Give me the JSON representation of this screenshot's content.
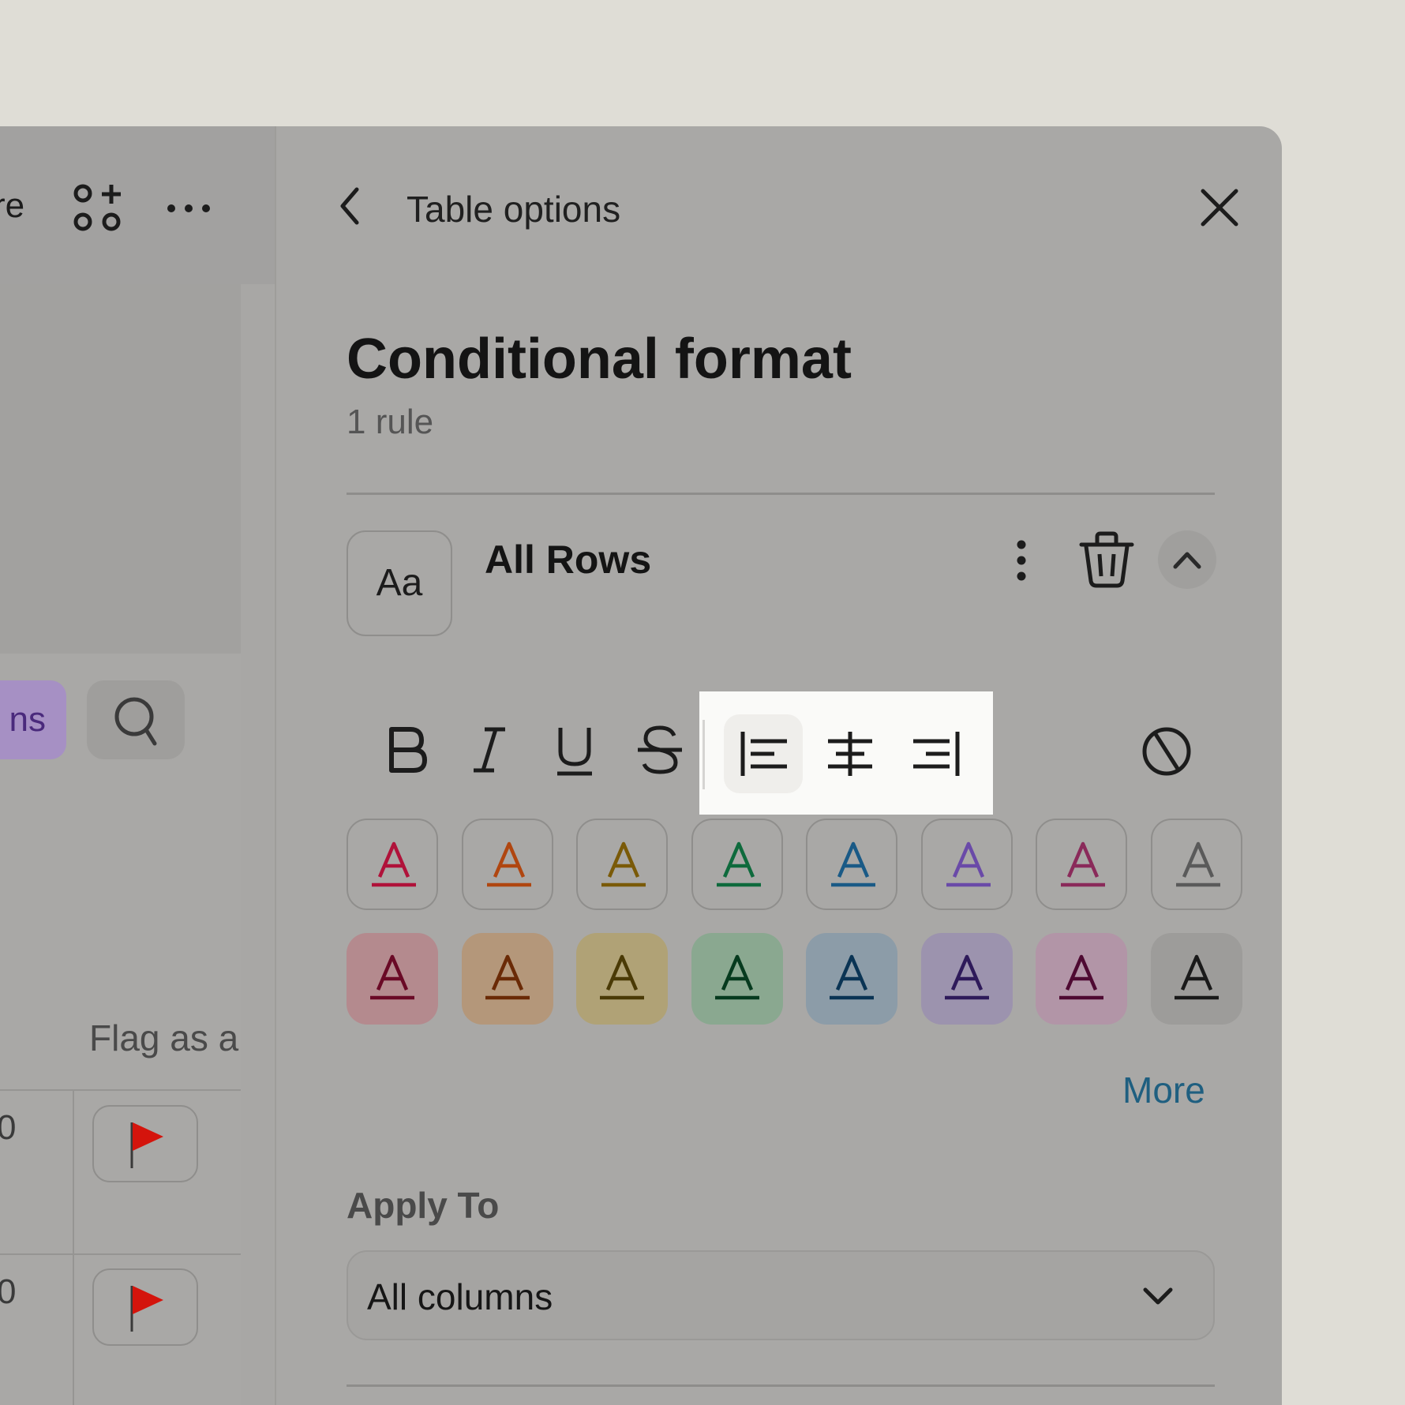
{
  "left": {
    "toolbar_text_fragment": "re",
    "pill_text_fragment": "ns",
    "column_header_fragment": "Flag as a",
    "rows": [
      {
        "value_fragment": "0"
      },
      {
        "value_fragment": "0"
      }
    ]
  },
  "panel": {
    "title": "Table options",
    "heading": "Conditional format",
    "subheading": "1 rule",
    "rule": {
      "preview_label": "Aa",
      "name": "All Rows"
    },
    "more_link": "More",
    "apply_to": {
      "label": "Apply To",
      "value": "All columns"
    }
  },
  "text_colors": [
    {
      "name": "red",
      "color": "#b0123a"
    },
    {
      "name": "orange",
      "color": "#b04610"
    },
    {
      "name": "yellow",
      "color": "#7a5a08"
    },
    {
      "name": "green",
      "color": "#0e6a3c"
    },
    {
      "name": "blue",
      "color": "#1a5a86"
    },
    {
      "name": "purple",
      "color": "#6a4aa8"
    },
    {
      "name": "pink",
      "color": "#8a2a5a"
    },
    {
      "name": "gray",
      "color": "#5a5a5a"
    }
  ],
  "fill_colors": [
    {
      "name": "red",
      "bg": "#b48a8e",
      "fg": "#6a0a26"
    },
    {
      "name": "orange",
      "bg": "#b4977a",
      "fg": "#6a2a06"
    },
    {
      "name": "yellow",
      "bg": "#b0a276",
      "fg": "#4a3a06"
    },
    {
      "name": "green",
      "bg": "#8aa890",
      "fg": "#063a1e"
    },
    {
      "name": "blue",
      "bg": "#8c9ca8",
      "fg": "#0a3454"
    },
    {
      "name": "purple",
      "bg": "#9c93ae",
      "fg": "#2e1a5a"
    },
    {
      "name": "pink",
      "bg": "#b295a7",
      "fg": "#4e0a32"
    },
    {
      "name": "gray",
      "bg": "#9d9c9a",
      "fg": "#1a1a1a"
    }
  ],
  "icons": {
    "back": "chevron-left-icon",
    "close": "close-icon",
    "apps": "apps-add-icon",
    "more": "more-horizontal-icon",
    "search": "search-icon",
    "flag": "flag-icon",
    "kebab": "kebab-icon",
    "delete": "trash-icon",
    "collapse": "chevron-up-icon",
    "bold": "bold-icon",
    "italic": "italic-icon",
    "underline": "underline-icon",
    "strikethrough": "strikethrough-icon",
    "align_left": "align-left-icon",
    "align_center": "align-center-icon",
    "align_right": "align-right-icon",
    "clear": "clear-format-icon",
    "dropdown": "chevron-down-icon"
  },
  "accent": {
    "link": "#1f5f80",
    "highlight": "#fafaf8",
    "flag": "#d4140c"
  }
}
